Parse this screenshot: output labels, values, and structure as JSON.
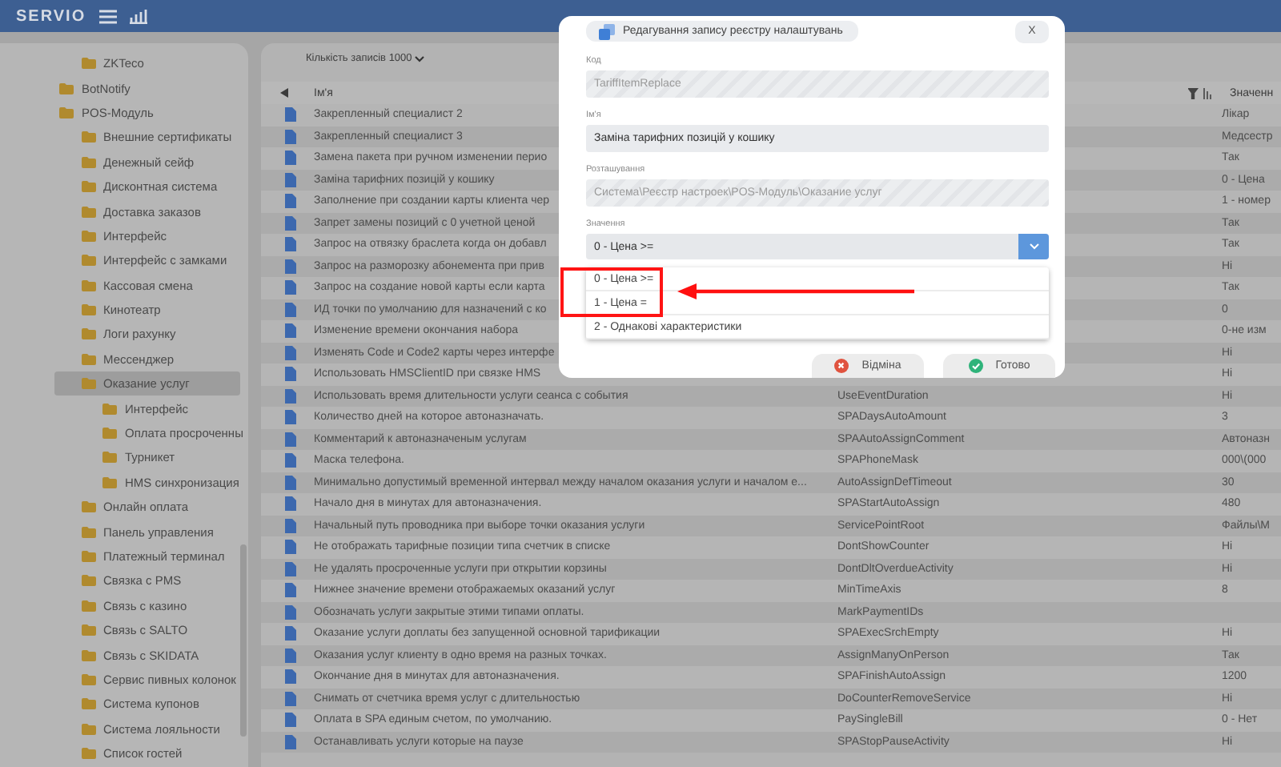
{
  "app": {
    "logo": "SERVIO"
  },
  "sidebar": {
    "tree": [
      {
        "children": [
          {
            "label": "ZKTeco",
            "selected": false
          }
        ]
      },
      {
        "label": "BotNotify",
        "selected": false
      },
      {
        "label": "POS-Модуль",
        "selected": false,
        "children": [
          {
            "label": "Внешние сертификаты",
            "selected": false
          },
          {
            "label": "Денежный сейф",
            "selected": false
          },
          {
            "label": "Дисконтная система",
            "selected": false
          },
          {
            "label": "Доставка заказов",
            "selected": false
          },
          {
            "label": "Интерфейс",
            "selected": false
          },
          {
            "label": "Интерфейс с замками",
            "selected": false
          },
          {
            "label": "Кассовая смена",
            "selected": false
          },
          {
            "label": "Кинотеатр",
            "selected": false
          },
          {
            "label": "Логи рахунку",
            "selected": false
          },
          {
            "label": "Мессенджер",
            "selected": false
          },
          {
            "label": "Оказание услуг",
            "selected": true,
            "children": [
              {
                "label": "Интерфейс",
                "selected": false
              },
              {
                "label": "Оплата просроченны",
                "selected": false
              },
              {
                "label": "Турникет",
                "selected": false
              },
              {
                "label": "HMS синхронизация",
                "selected": false
              }
            ]
          },
          {
            "label": "Онлайн оплата",
            "selected": false
          },
          {
            "label": "Панель управления",
            "selected": false
          },
          {
            "label": "Платежный терминал",
            "selected": false
          },
          {
            "label": "Связка с PMS",
            "selected": false
          },
          {
            "label": "Связь с казино",
            "selected": false
          },
          {
            "label": "Связь с SALTO",
            "selected": false
          },
          {
            "label": "Связь с SKIDATA",
            "selected": false
          },
          {
            "label": "Сервис пивных колонок",
            "selected": false
          },
          {
            "label": "Система купонов",
            "selected": false
          },
          {
            "label": "Система лояльности",
            "selected": false
          },
          {
            "label": "Список гостей",
            "selected": false
          }
        ]
      }
    ]
  },
  "table": {
    "records": "Кількість записів 1000",
    "header": {
      "name": "Ім'я",
      "value": "Значенн"
    },
    "rows": [
      {
        "name": "Закрепленный специалист 2",
        "value": "Лікар"
      },
      {
        "name": "Закрепленный специалист 3",
        "value": "Медсестр"
      },
      {
        "name": "Замена пакета при ручном изменении перио",
        "value": "Так"
      },
      {
        "name": "Заміна тарифних позицій у кошику",
        "value": "0 - Цена"
      },
      {
        "name": "Заполнение при создании карты клиента чер",
        "value": "1 - номер"
      },
      {
        "name": "Запрет замены позиций с 0 учетной ценой",
        "value": "Так"
      },
      {
        "name": "Запрос на отвязку браслета когда он добавл",
        "value": "Так"
      },
      {
        "name": "Запрос на разморозку абонемента при прив",
        "value": "Ні"
      },
      {
        "name": "Запрос на создание новой карты если карта",
        "value": "Так"
      },
      {
        "name": "ИД точки по умолчанию для назначений с ко",
        "value": "0"
      },
      {
        "name": "Изменение времени окончания набора",
        "value": "0-не изм"
      },
      {
        "name": "Изменять Code и Code2 карты через интерфе",
        "value": "Ні"
      },
      {
        "name": "Использовать HMSClientID при связке HMS",
        "value": "Ні"
      },
      {
        "name": "Использовать время длительности услуги сеанса с события",
        "code": "UseEventDuration",
        "value": "Ні"
      },
      {
        "name": "Количество дней на которое автоназначать.",
        "code": "SPADaysAutoAmount",
        "value": "3"
      },
      {
        "name": "Комментарий к автоназначеным услугам",
        "code": "SPAAutoAssignComment",
        "value": "Автоназн"
      },
      {
        "name": "Маска телефона.",
        "code": "SPAPhoneMask",
        "value": "000\\(000"
      },
      {
        "name": "Минимально допустимый временной интервал между началом оказания услуги и началом е...",
        "code": "AutoAssignDefTimeout",
        "value": "30"
      },
      {
        "name": "Начало дня в минутах для автоназначения.",
        "code": "SPAStartAutoAssign",
        "value": "480"
      },
      {
        "name": "Начальный путь проводника при выборе точки оказания услуги",
        "code": "ServicePointRoot",
        "value": "Файлы\\М"
      },
      {
        "name": "Не отображать тарифные позиции типа счетчик в списке",
        "code": "DontShowCounter",
        "value": "Ні"
      },
      {
        "name": "Не удалять просроченные услуги при открытии корзины",
        "code": "DontDltOverdueActivity",
        "value": "Ні"
      },
      {
        "name": "Нижнее значение времени отображаемых оказаний услуг",
        "code": "MinTimeAxis",
        "value": "8"
      },
      {
        "name": "Обозначать услуги закрытые этими типами оплаты.",
        "code": "MarkPaymentIDs"
      },
      {
        "name": "Оказание услуги доплаты без запущенной основной тарификации",
        "code": "SPAExecSrchEmpty",
        "value": "Ні"
      },
      {
        "name": "Оказания услуг клиенту в одно время на разных точках.",
        "code": "AssignManyOnPerson",
        "value": "Так"
      },
      {
        "name": "Окончание дня в минутах для автоназначения.",
        "code": "SPAFinishAutoAssign",
        "value": "1200"
      },
      {
        "name": "Снимать от счетчика время услуг с длительностью",
        "code": "DoCounterRemoveService",
        "value": "Ні"
      },
      {
        "name": "Оплата в SPA единым счетом, по умолчанию.",
        "code": "PaySingleBill",
        "value": "0 - Нет"
      },
      {
        "name": "Останавливать услуги которые на паузе",
        "code": "SPAStopPauseActivity",
        "value": "Ні"
      }
    ]
  },
  "dialog": {
    "title": "Редагування запису реєстру налаштувань",
    "close": "X",
    "fields": [
      {
        "label": "Код",
        "value": "TariffItemReplace",
        "disabled": true
      },
      {
        "label": "Ім'я",
        "value": "Заміна тарифних позицій у кошику",
        "disabled": false
      },
      {
        "label": "Розташування",
        "value": "Система\\Реєстр настроек\\POS-Модуль\\Оказание услуг",
        "disabled": true
      }
    ],
    "select": {
      "label": "Значення",
      "value": "0 - Цена >=",
      "options": [
        "0 - Цена >=",
        "1 - Цена =",
        "2 - Однакові характеристики"
      ]
    },
    "buttons": [
      {
        "label": "Відміна",
        "kind": "cancel"
      },
      {
        "label": "Готово",
        "kind": "ok"
      }
    ]
  }
}
